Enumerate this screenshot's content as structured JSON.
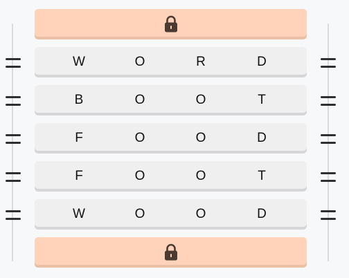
{
  "puzzle": {
    "top_lock": {
      "icon": "lock-icon"
    },
    "bottom_lock": {
      "icon": "lock-icon"
    },
    "rows": [
      {
        "letters": [
          "W",
          "O",
          "R",
          "D"
        ]
      },
      {
        "letters": [
          "B",
          "O",
          "O",
          "T"
        ]
      },
      {
        "letters": [
          "F",
          "O",
          "O",
          "D"
        ]
      },
      {
        "letters": [
          "F",
          "O",
          "O",
          "T"
        ]
      },
      {
        "letters": [
          "W",
          "O",
          "O",
          "D"
        ]
      }
    ],
    "handle_icon": "drag-handle-icon"
  },
  "colors": {
    "background": "#f7f8fa",
    "lock_bar": "#ffd3b9",
    "row_bg": "#efefef",
    "letter": "#111111",
    "lock_icon": "#4a3a32",
    "handle": "#2f2f33"
  }
}
